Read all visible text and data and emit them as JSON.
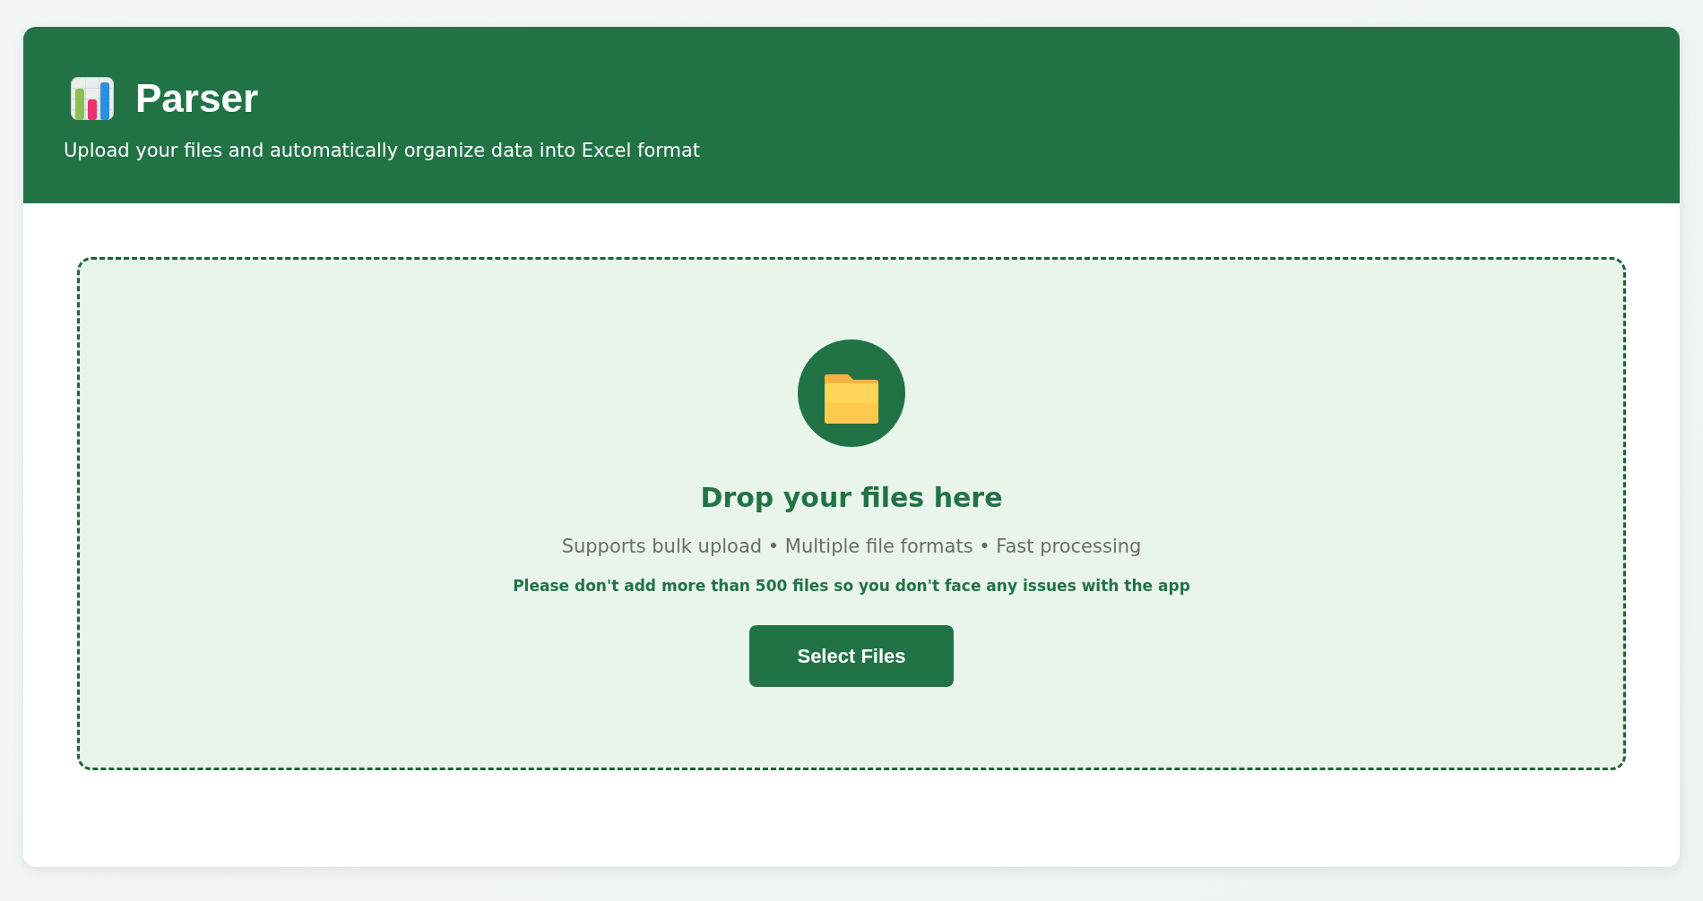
{
  "header": {
    "title": "Parser",
    "subtitle": "Upload your files and automatically organize data into Excel format"
  },
  "upload": {
    "heading": "Drop your files here",
    "features": "Supports bulk upload • Multiple file formats • Fast processing",
    "warning": "Please don't add more than 500 files so you don't face any issues with the app",
    "button": "Select Files"
  }
}
